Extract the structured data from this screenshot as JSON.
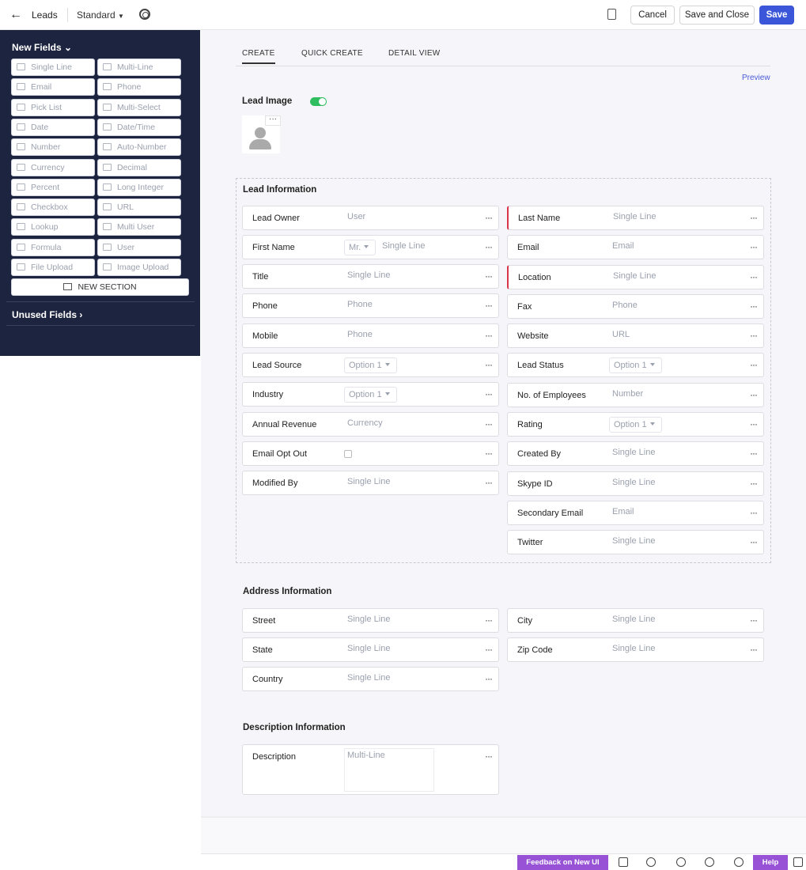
{
  "topbar": {
    "module": "Leads",
    "layout": "Standard",
    "cancel": "Cancel",
    "save_close": "Save and Close",
    "save": "Save"
  },
  "sidebar": {
    "new_fields": "New Fields",
    "items": [
      "Single Line",
      "Multi-Line",
      "Email",
      "Phone",
      "Pick List",
      "Multi-Select",
      "Date",
      "Date/Time",
      "Number",
      "Auto-Number",
      "Currency",
      "Decimal",
      "Percent",
      "Long Integer",
      "Checkbox",
      "URL",
      "Lookup",
      "Multi User",
      "Formula",
      "User",
      "File Upload",
      "Image Upload"
    ],
    "icons": [
      "single-line-icon",
      "multi-line-icon",
      "email-icon",
      "phone-icon",
      "pick-list-icon",
      "multi-select-icon",
      "date-icon",
      "date-time-icon",
      "number-icon",
      "auto-number-icon",
      "currency-icon",
      "decimal-icon",
      "percent-icon",
      "long-integer-icon",
      "checkbox-icon",
      "url-icon",
      "lookup-icon",
      "multi-user-icon",
      "formula-icon",
      "user-icon",
      "file-upload-icon",
      "image-upload-icon"
    ],
    "new_section": "NEW SECTION",
    "unused_fields": "Unused Fields"
  },
  "tabs": [
    "CREATE",
    "QUICK CREATE",
    "DETAIL VIEW"
  ],
  "preview": "Preview",
  "lead_image": "Lead Image",
  "lead_information": {
    "title": "Lead Information",
    "left": [
      {
        "label": "Lead Owner",
        "placeholder": "User"
      },
      {
        "label": "First Name",
        "salutation": "Mr.",
        "placeholder": "Single Line"
      },
      {
        "label": "Title",
        "placeholder": "Single Line"
      },
      {
        "label": "Phone",
        "placeholder": "Phone"
      },
      {
        "label": "Mobile",
        "placeholder": "Phone"
      },
      {
        "label": "Lead Source",
        "select": "Option 1"
      },
      {
        "label": "Industry",
        "select": "Option 1"
      },
      {
        "label": "Annual Revenue",
        "placeholder": "Currency"
      },
      {
        "label": "Email Opt Out",
        "checkbox": true
      },
      {
        "label": "Modified By",
        "placeholder": "Single Line"
      }
    ],
    "right": [
      {
        "label": "Last Name",
        "placeholder": "Single Line",
        "required": true
      },
      {
        "label": "Email",
        "placeholder": "Email"
      },
      {
        "label": "Location",
        "placeholder": "Single Line",
        "required": true
      },
      {
        "label": "Fax",
        "placeholder": "Phone"
      },
      {
        "label": "Website",
        "placeholder": "URL"
      },
      {
        "label": "Lead Status",
        "select": "Option 1"
      },
      {
        "label": "No. of Employees",
        "placeholder": "Number"
      },
      {
        "label": "Rating",
        "select": "Option 1"
      },
      {
        "label": "Created By",
        "placeholder": "Single Line"
      },
      {
        "label": "Skype ID",
        "placeholder": "Single Line"
      },
      {
        "label": "Secondary Email",
        "placeholder": "Email"
      },
      {
        "label": "Twitter",
        "placeholder": "Single Line"
      }
    ]
  },
  "address_information": {
    "title": "Address Information",
    "left": [
      {
        "label": "Street",
        "placeholder": "Single Line"
      },
      {
        "label": "State",
        "placeholder": "Single Line"
      },
      {
        "label": "Country",
        "placeholder": "Single Line"
      }
    ],
    "right": [
      {
        "label": "City",
        "placeholder": "Single Line"
      },
      {
        "label": "Zip Code",
        "placeholder": "Single Line"
      }
    ]
  },
  "description_information": {
    "title": "Description Information",
    "field": {
      "label": "Description",
      "placeholder": "Multi-Line"
    }
  },
  "statusbar": {
    "feedback": "Feedback on New UI",
    "help": "Help"
  },
  "colors": {
    "sidebar_bg": "#1d2440",
    "primary": "#3b56d9",
    "toggle": "#2fbe5f",
    "required": "#d8344a",
    "statusbar_accent": "#9752d6"
  }
}
